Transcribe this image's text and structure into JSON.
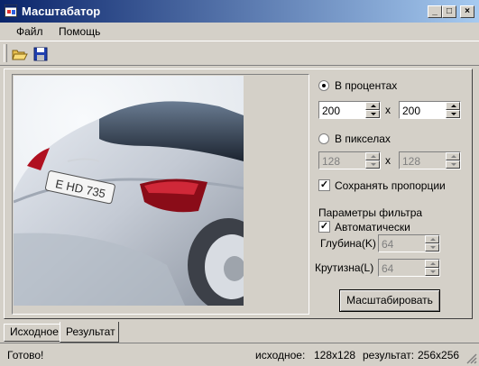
{
  "window": {
    "title": "Масштабатор"
  },
  "menu": {
    "file": "Файл",
    "help": "Помощь"
  },
  "toolbar": {
    "open_icon": "folder-open-icon",
    "save_icon": "floppy-save-icon"
  },
  "options": {
    "percent_label": "В процентах",
    "percent_selected": true,
    "percent_width": "200",
    "percent_height": "200",
    "times": "x",
    "pixels_label": "В пикселах",
    "pixel_width": "128",
    "pixel_height": "128",
    "keep_ratio_label": "Сохранять пропорции",
    "keep_ratio_checked": true,
    "filter_title": "Параметры фильтра",
    "auto_label": "Автоматически",
    "auto_checked": true,
    "depth_label": "Глубина(K)",
    "depth_value": "64",
    "slope_label": "Крутизна(L)",
    "slope_value": "64",
    "scale_button": "Масштабировать"
  },
  "tabs": [
    {
      "label": "Исходное",
      "active": false
    },
    {
      "label": "Результат",
      "active": true
    }
  ],
  "status": {
    "ready": "Готово!",
    "source_label": "исходное:",
    "source_size": "128x128",
    "result_label": "результат:",
    "result_size": "256x256"
  }
}
